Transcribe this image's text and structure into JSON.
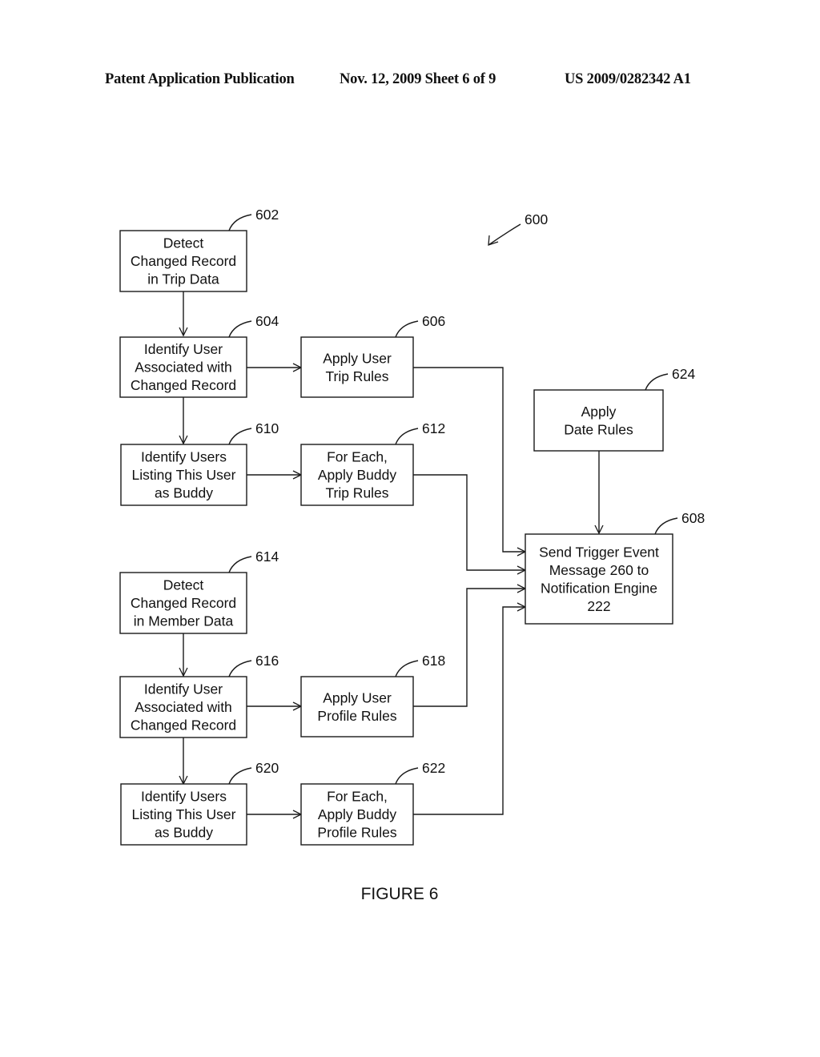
{
  "header": {
    "left": "Patent Application Publication",
    "middle": "Nov. 12, 2009   Sheet 6 of 9",
    "right": "US 2009/0282342 A1"
  },
  "figure": {
    "ref": "600",
    "caption": "FIGURE 6"
  },
  "nodes": {
    "n602": {
      "ref": "602",
      "lines": [
        "Detect",
        "Changed Record",
        "in Trip Data"
      ]
    },
    "n604": {
      "ref": "604",
      "lines": [
        "Identify User",
        "Associated with",
        "Changed Record"
      ]
    },
    "n606": {
      "ref": "606",
      "lines": [
        "Apply User",
        "Trip Rules"
      ]
    },
    "n610": {
      "ref": "610",
      "lines": [
        "Identify Users",
        "Listing This User",
        "as Buddy"
      ]
    },
    "n612": {
      "ref": "612",
      "lines": [
        "For Each,",
        "Apply Buddy",
        "Trip Rules"
      ]
    },
    "n614": {
      "ref": "614",
      "lines": [
        "Detect",
        "Changed Record",
        "in Member Data"
      ]
    },
    "n616": {
      "ref": "616",
      "lines": [
        "Identify User",
        "Associated with",
        "Changed Record"
      ]
    },
    "n618": {
      "ref": "618",
      "lines": [
        "Apply User",
        "Profile Rules"
      ]
    },
    "n620": {
      "ref": "620",
      "lines": [
        "Identify Users",
        "Listing This User",
        "as Buddy"
      ]
    },
    "n622": {
      "ref": "622",
      "lines": [
        "For Each,",
        "Apply Buddy",
        "Profile Rules"
      ]
    },
    "n624": {
      "ref": "624",
      "lines": [
        "Apply",
        "Date Rules"
      ]
    },
    "n608": {
      "ref": "608",
      "lines": [
        "Send Trigger Event",
        "Message 260 to",
        "Notification Engine",
        "222"
      ]
    }
  },
  "edges": [
    {
      "from": "602",
      "to": "604"
    },
    {
      "from": "604",
      "to": "606"
    },
    {
      "from": "604",
      "to": "610"
    },
    {
      "from": "610",
      "to": "612"
    },
    {
      "from": "614",
      "to": "616"
    },
    {
      "from": "616",
      "to": "618"
    },
    {
      "from": "616",
      "to": "620"
    },
    {
      "from": "620",
      "to": "622"
    },
    {
      "from": "606",
      "to": "608"
    },
    {
      "from": "612",
      "to": "608"
    },
    {
      "from": "618",
      "to": "608"
    },
    {
      "from": "622",
      "to": "608"
    },
    {
      "from": "624",
      "to": "608"
    }
  ]
}
